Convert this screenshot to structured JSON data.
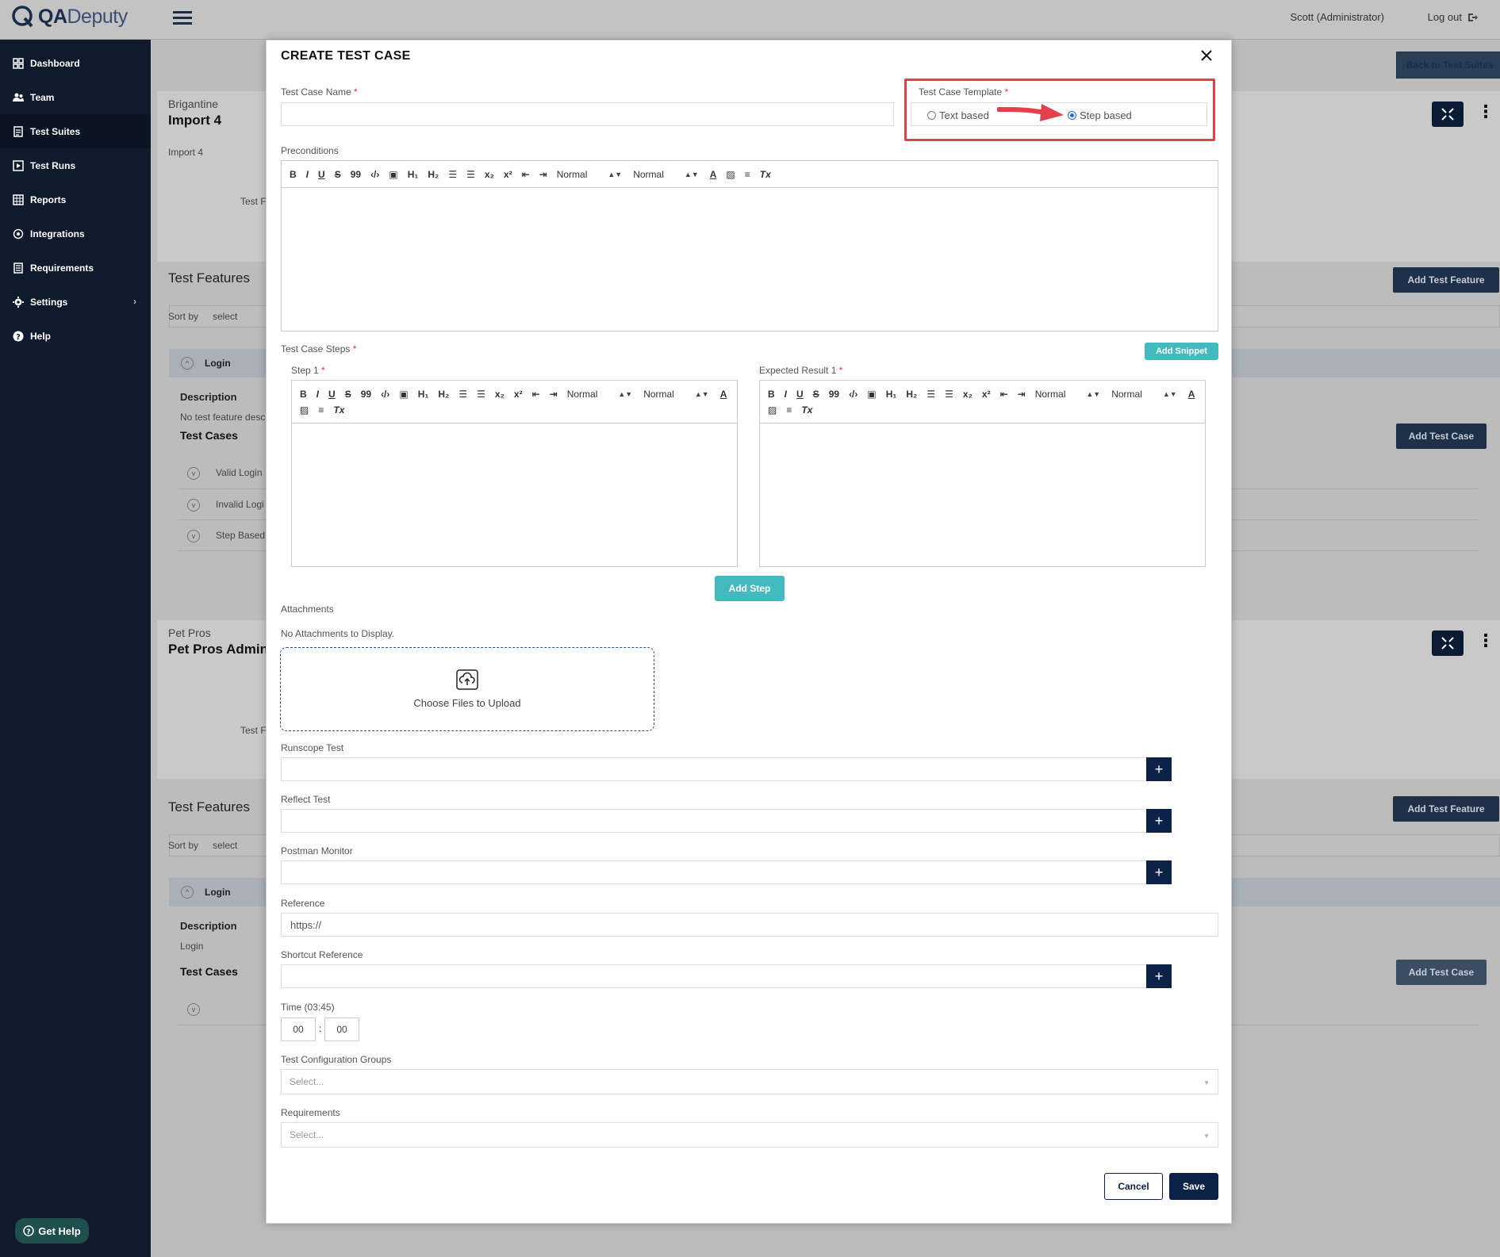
{
  "header": {
    "logo_text_bold": "QA",
    "logo_text_light": "Deputy",
    "user": "Scott (Administrator)",
    "logout": "Log out"
  },
  "sidebar": {
    "items": [
      {
        "label": "Dashboard",
        "icon": "dashboard-icon"
      },
      {
        "label": "Team",
        "icon": "team-icon"
      },
      {
        "label": "Test Suites",
        "icon": "test-suites-icon"
      },
      {
        "label": "Test Runs",
        "icon": "test-runs-icon"
      },
      {
        "label": "Reports",
        "icon": "reports-icon"
      },
      {
        "label": "Integrations",
        "icon": "integrations-icon"
      },
      {
        "label": "Requirements",
        "icon": "requirements-icon"
      },
      {
        "label": "Settings",
        "icon": "gear-icon"
      },
      {
        "label": "Help",
        "icon": "help-icon"
      }
    ],
    "get_help": "Get Help"
  },
  "background": {
    "back_button": "Back to Test Suites",
    "suite1": {
      "project": "Brigantine",
      "name": "Import 4",
      "desc": "Import 4",
      "test_label": "Test F"
    },
    "suite2": {
      "project": "Pet Pros",
      "name": "Pet Pros Admin",
      "test_label": "Test F"
    },
    "test_features": "Test Features",
    "add_test_feature": "Add Test Feature",
    "sort_by": "Sort by",
    "sort_select": "select",
    "feature_login": "Login",
    "description": "Description",
    "no_feature_desc": "No test feature desc",
    "login_desc": "Login",
    "test_cases": "Test Cases",
    "add_test_case": "Add Test Case",
    "cases": [
      "Valid Login",
      "Invalid Logi",
      "Step Based"
    ]
  },
  "modal": {
    "title": "CREATE TEST CASE",
    "test_case_name_label": "Test Case Name",
    "template_label": "Test Case Template",
    "template_options": [
      "Text based",
      "Step based"
    ],
    "template_selected": "Step based",
    "preconditions_label": "Preconditions",
    "editor_toolbar": {
      "bold": "B",
      "italic": "I",
      "underline": "U",
      "strike": "S",
      "quote": "99",
      "code": "‹/›",
      "image": "▣",
      "h1": "H₁",
      "h2": "H₂",
      "sub": "x₂",
      "sup": "x²",
      "size": "Normal",
      "header": "Normal",
      "color": "A",
      "clear": "Tx"
    },
    "steps_label": "Test Case Steps",
    "add_snippet": "Add Snippet",
    "step_label": "Step 1",
    "expected_label": "Expected Result 1",
    "add_step": "Add Step",
    "attachments_label": "Attachments",
    "no_attachments": "No Attachments to Display.",
    "choose_files": "Choose Files to Upload",
    "runscope_label": "Runscope Test",
    "reflect_label": "Reflect Test",
    "postman_label": "Postman Monitor",
    "reference_label": "Reference",
    "reference_value": "https://",
    "shortcut_label": "Shortcut Reference",
    "time_label": "Time (03:45)",
    "time_minutes": "00",
    "time_seconds": "00",
    "time_sep": ":",
    "config_groups_label": "Test Configuration Groups",
    "config_placeholder": "Select...",
    "requirements_label": "Requirements",
    "requirements_placeholder": "Select...",
    "cancel": "Cancel",
    "save": "Save",
    "plus": "+"
  }
}
